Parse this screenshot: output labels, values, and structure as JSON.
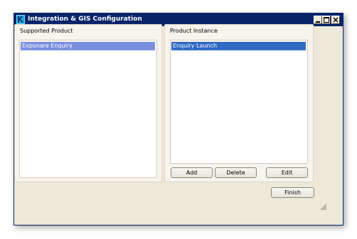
{
  "window": {
    "title": "Integration & GIS Configuration"
  },
  "supported_product": {
    "group_title": "Supported Product",
    "items": [
      {
        "label": "Exponare Enquiry",
        "selected": true
      }
    ]
  },
  "product_instance": {
    "group_title": "Product Instance",
    "items": [
      {
        "label": "Enquiry Launch",
        "selected": true
      }
    ],
    "buttons": {
      "add": "Add",
      "delete": "Delete",
      "edit": "Edit"
    }
  },
  "footer": {
    "finish": "Finish"
  },
  "colors": {
    "titlebar": "#0a246a",
    "dialog_face": "#ece9d8",
    "selected_inactive": "#7a8fe0",
    "selected_active": "#316ac5",
    "group_border": "#e3d4c9"
  },
  "icons": {
    "app": "app-icon",
    "minimize": "minimize-icon",
    "maximize": "maximize-icon",
    "close": "close-icon",
    "resize": "resize-grip-icon"
  }
}
